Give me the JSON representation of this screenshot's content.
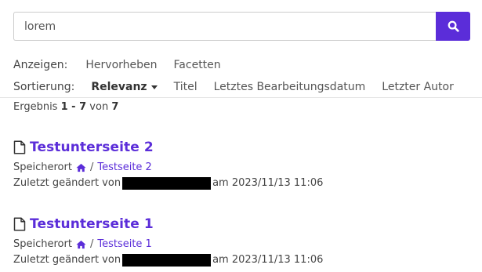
{
  "search": {
    "value": "lorem"
  },
  "show": {
    "label": "Anzeigen:",
    "options": [
      "Hervorheben",
      "Facetten"
    ]
  },
  "sort": {
    "label": "Sortierung:",
    "active": "Relevanz",
    "options": [
      "Titel",
      "Letztes Bearbeitungsdatum",
      "Letzter Autor"
    ]
  },
  "results": {
    "prefix": "Ergebnis",
    "range": "1 - 7",
    "of": "von",
    "total": "7",
    "hits": [
      {
        "title": "Testunterseite 2",
        "location_label": "Speicherort",
        "separator": "/",
        "location_link": "Testseite 2",
        "modified_prefix": "Zuletzt geändert von",
        "modified_suffix": "am 2023/11/13 11:06"
      },
      {
        "title": "Testunterseite 1",
        "location_label": "Speicherort",
        "separator": "/",
        "location_link": "Testseite 1",
        "modified_prefix": "Zuletzt geändert von",
        "modified_suffix": "am 2023/11/13 11:06"
      }
    ]
  },
  "colors": {
    "accent": "#5b2dd9",
    "redaction": "#000000"
  },
  "icons": {
    "search": "search-icon",
    "document": "document-icon",
    "home": "home-icon",
    "caret": "caret-down-icon"
  }
}
